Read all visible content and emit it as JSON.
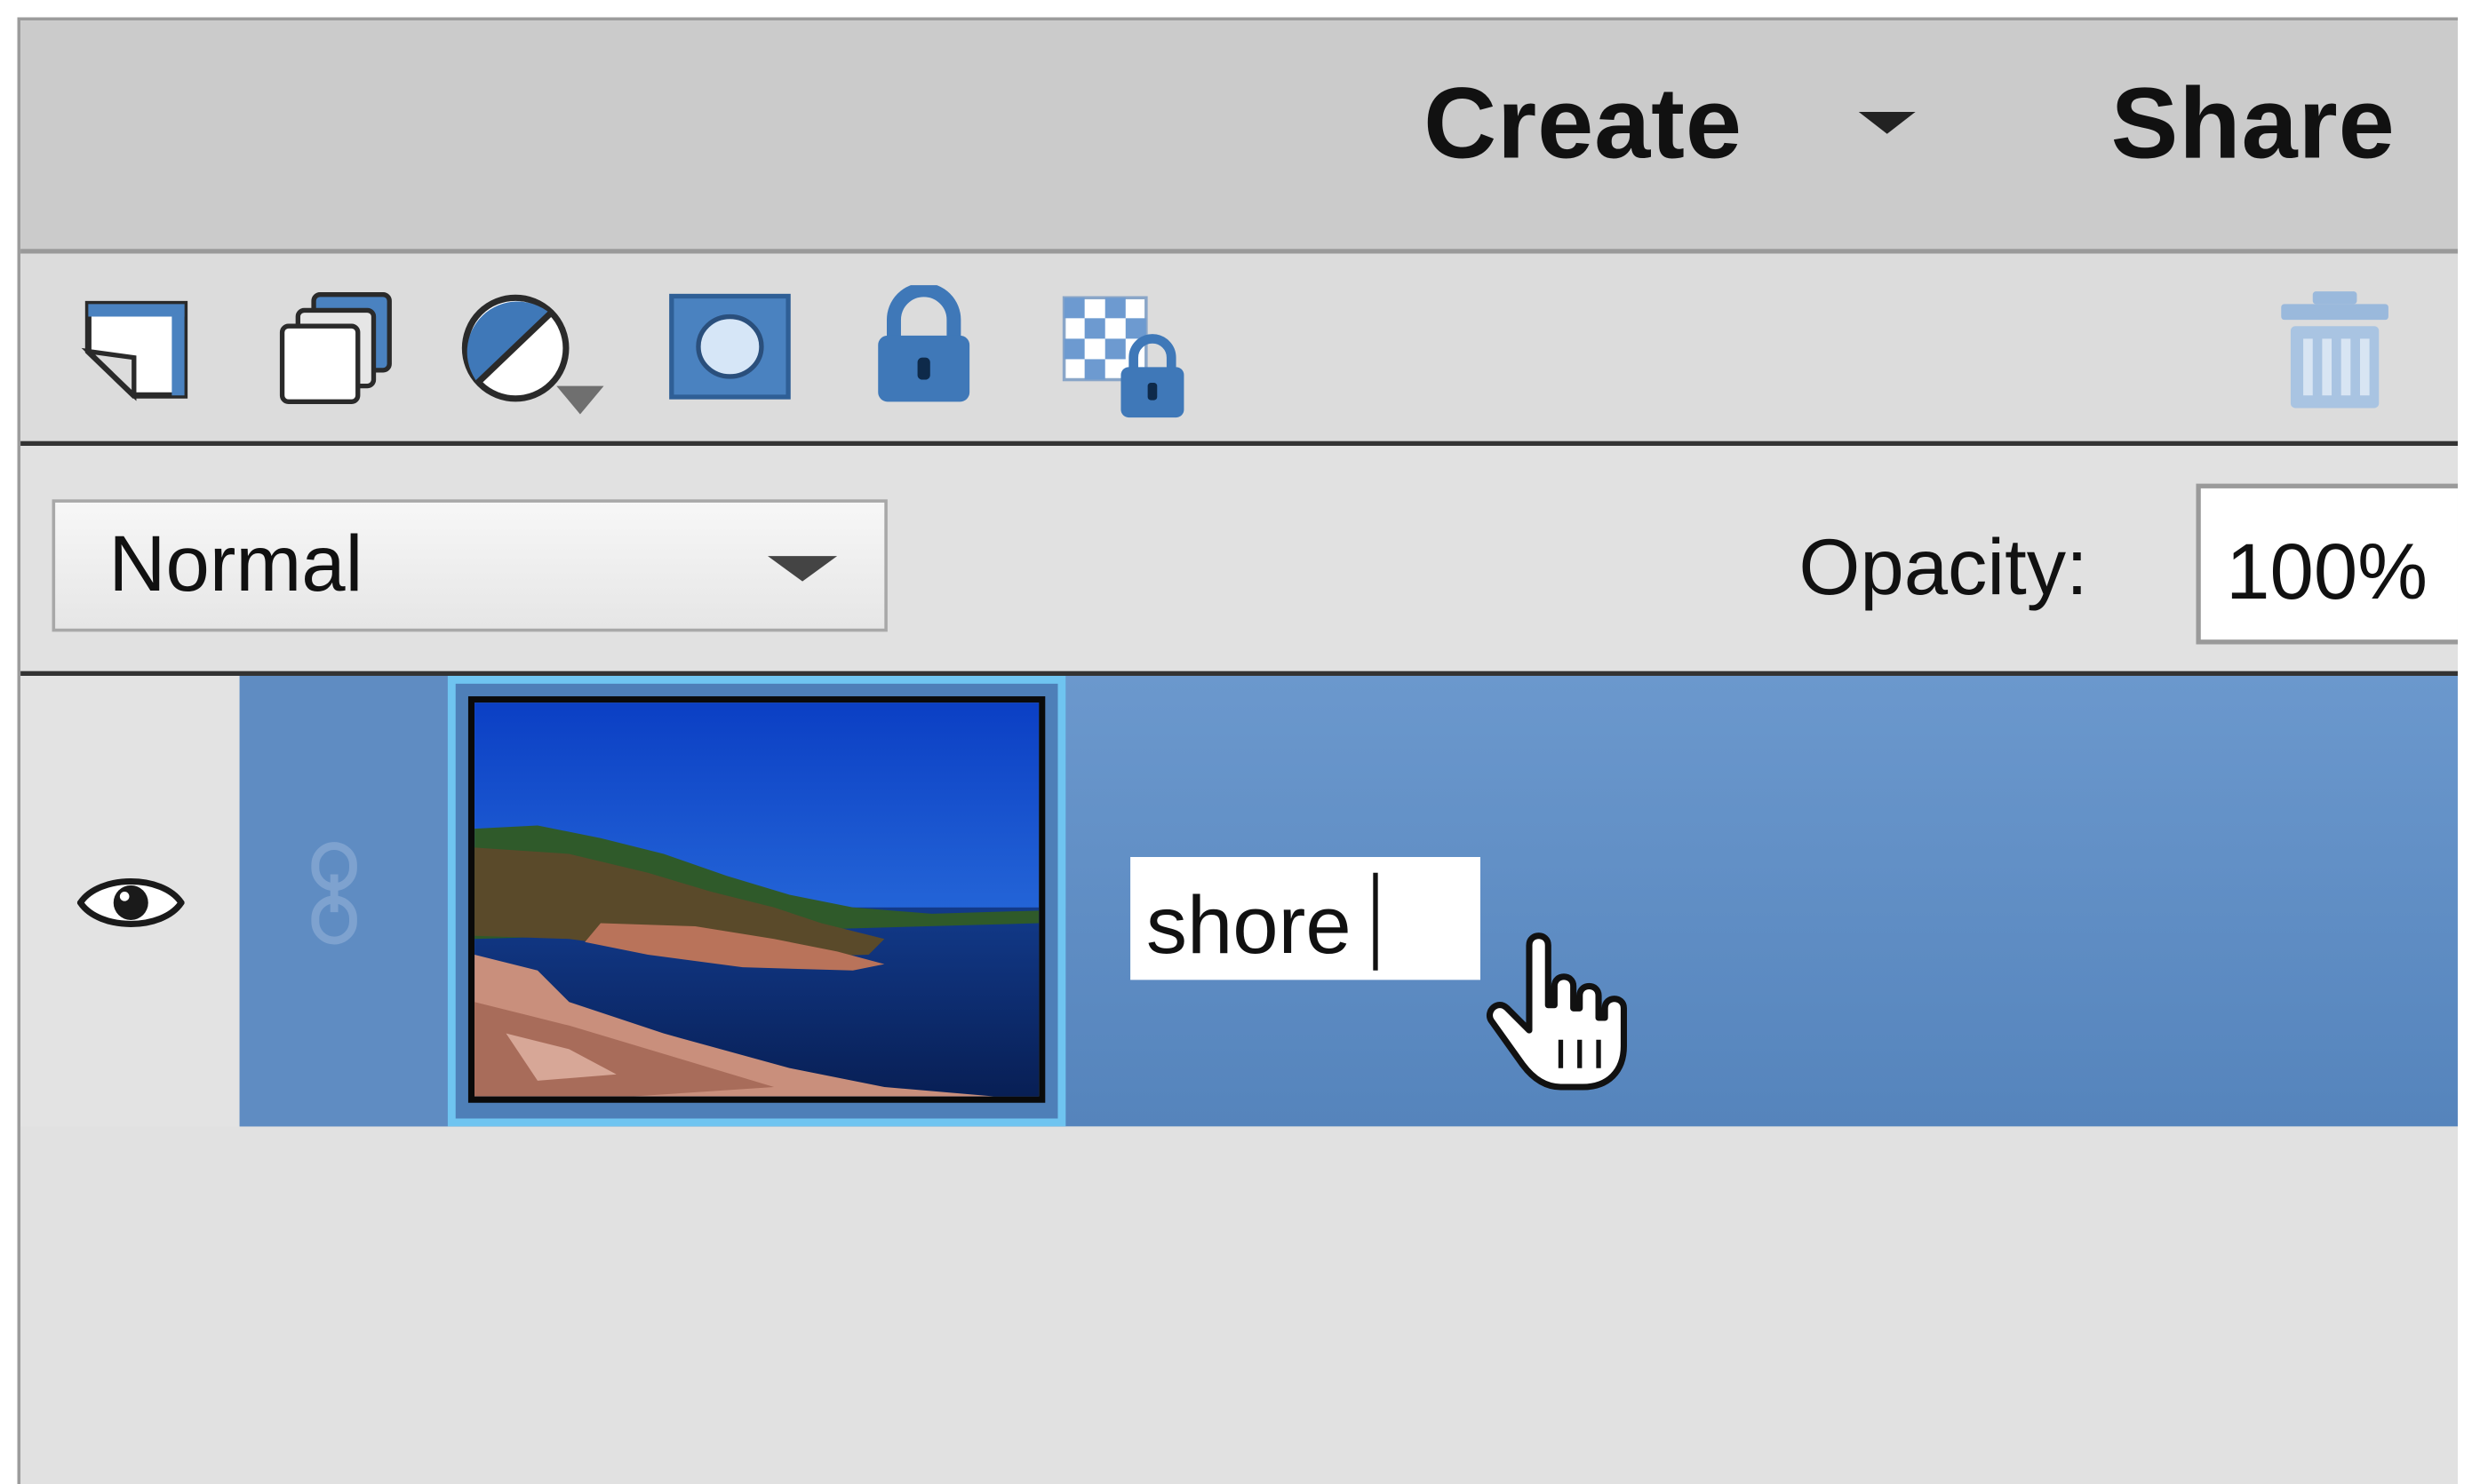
{
  "menubar": {
    "create_label": "Create",
    "share_label": "Share"
  },
  "toolbar": {
    "icons": [
      "new-layer-icon",
      "duplicate-layers-icon",
      "adjustment-layer-icon",
      "layer-mask-icon",
      "lock-all-icon",
      "lock-transparency-icon",
      "trash-icon"
    ]
  },
  "blend": {
    "mode": "Normal",
    "opacity_label": "Opacity:",
    "opacity_value": "100%"
  },
  "layer": {
    "name_value": "shore",
    "visible": true,
    "selected": true
  },
  "colors": {
    "selection_blue": "#6b98cd",
    "thumb_border": "#6fc4f0",
    "icon_blue": "#3f78b8"
  }
}
